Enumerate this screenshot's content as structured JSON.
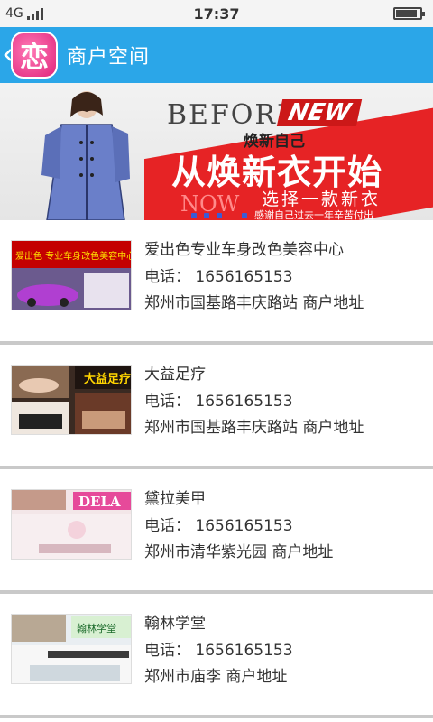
{
  "status_bar": {
    "network": "4G",
    "time": "17:37"
  },
  "header": {
    "logo_char": "恋",
    "title": "商户空间"
  },
  "banner": {
    "before": "BEFORE",
    "new": "NEW",
    "sub1": "焕新自己",
    "main": "从焕新衣开始",
    "now": "NOW",
    "sub2": "选择一款新衣",
    "sub3": "感谢自己过去一年辛苦付出"
  },
  "merchants": [
    {
      "name": "爱出色专业车身改色美容中心",
      "phone": "电话： 1656165153",
      "address": "郑州市国基路丰庆路站   商户地址",
      "thumb_text": "爱出色  专业车身改色美容中心"
    },
    {
      "name": "大益足疗",
      "phone": "电话： 1656165153",
      "address": "郑州市国基路丰庆路站   商户地址",
      "thumb_text": "大益足疗"
    },
    {
      "name": "黛拉美甲",
      "phone": "电话： 1656165153",
      "address": "郑州市清华紫光园   商户地址",
      "thumb_text": "DELA"
    },
    {
      "name": "翰林学堂",
      "phone": "电话： 1656165153",
      "address": "郑州市庙李   商户地址",
      "thumb_text": "翰林学堂"
    }
  ],
  "colors": {
    "header": "#2ba6e8",
    "banner_red": "#e62325",
    "divider": "#c9c9c9"
  }
}
